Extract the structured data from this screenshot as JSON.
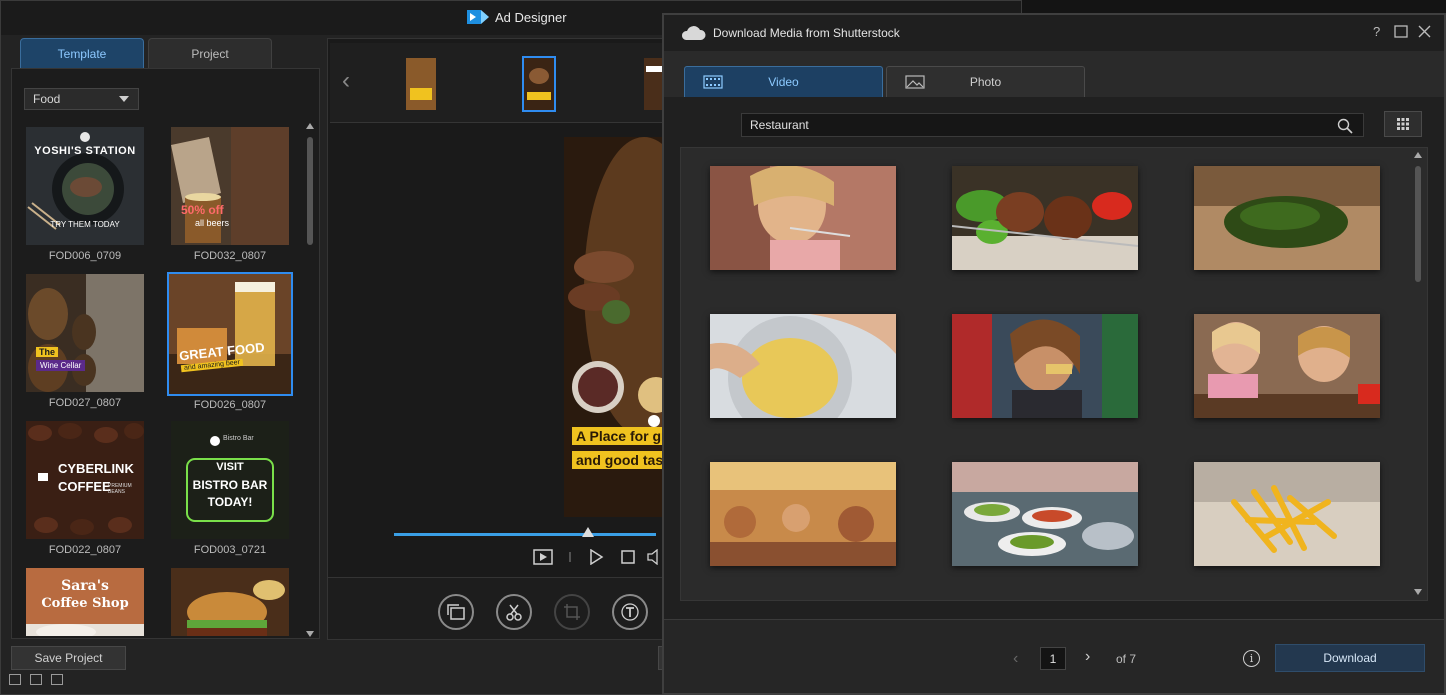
{
  "app": {
    "title": "Ad Designer",
    "tabs": [
      {
        "label": "Template",
        "active": true
      },
      {
        "label": "Project",
        "active": false
      }
    ],
    "category": "Food",
    "templates": [
      {
        "id": "FOD006_0709",
        "selected": false
      },
      {
        "id": "FOD032_0807",
        "selected": false
      },
      {
        "id": "FOD027_0807",
        "selected": false
      },
      {
        "id": "FOD026_0807",
        "selected": true
      },
      {
        "id": "FOD022_0807",
        "selected": false
      },
      {
        "id": "FOD003_0721",
        "selected": false
      },
      {
        "id": "",
        "selected": false
      },
      {
        "id": "",
        "selected": false
      }
    ],
    "thumb_text": {
      "yoshi_title": "YOSHI'S STATION",
      "yoshi_sub": "TRY THEM TODAY",
      "discount": "50% off",
      "discount_sub": "all beers",
      "wine_the": "The",
      "wine_name": "Wine Cellar",
      "great_food": "GREAT FOOD",
      "great_food_sub": "and amazing beer",
      "cyberlink": "CYBERLINK",
      "coffee": "COFFEE",
      "coffee_sub": "PREMIUM BEANS",
      "bistro_brand": "Bistro Bar",
      "visit": "VISIT",
      "bistro_bar": "BISTRO BAR",
      "today": "TODAY!",
      "saras": "Sara's",
      "coffee_shop": "Coffee Shop"
    },
    "save_project_label": "Save Project",
    "preview_text": [
      "A Place for gr",
      "and good tast"
    ],
    "playback_progress": 0.97,
    "edit_tools": [
      "media-swap",
      "trim",
      "crop",
      "text"
    ],
    "colors": {
      "accent": "#2f8cf0",
      "highlight": "#f0c21f"
    }
  },
  "dialog": {
    "title": "Download Media from Shutterstock",
    "tabs": [
      {
        "label": "Video",
        "active": true
      },
      {
        "label": "Photo",
        "active": false
      }
    ],
    "search_value": "Restaurant",
    "results": [
      {
        "subject": "girl-eating"
      },
      {
        "subject": "kebab-skewer"
      },
      {
        "subject": "chopped-herbs"
      },
      {
        "subject": "kneading-dough"
      },
      {
        "subject": "woman-eating"
      },
      {
        "subject": "kids-eating"
      },
      {
        "subject": "restaurant-interior"
      },
      {
        "subject": "salad-buffet"
      },
      {
        "subject": "french-fries"
      }
    ],
    "pagination": {
      "current": "1",
      "total_label": "of 7"
    },
    "download_label": "Download"
  }
}
